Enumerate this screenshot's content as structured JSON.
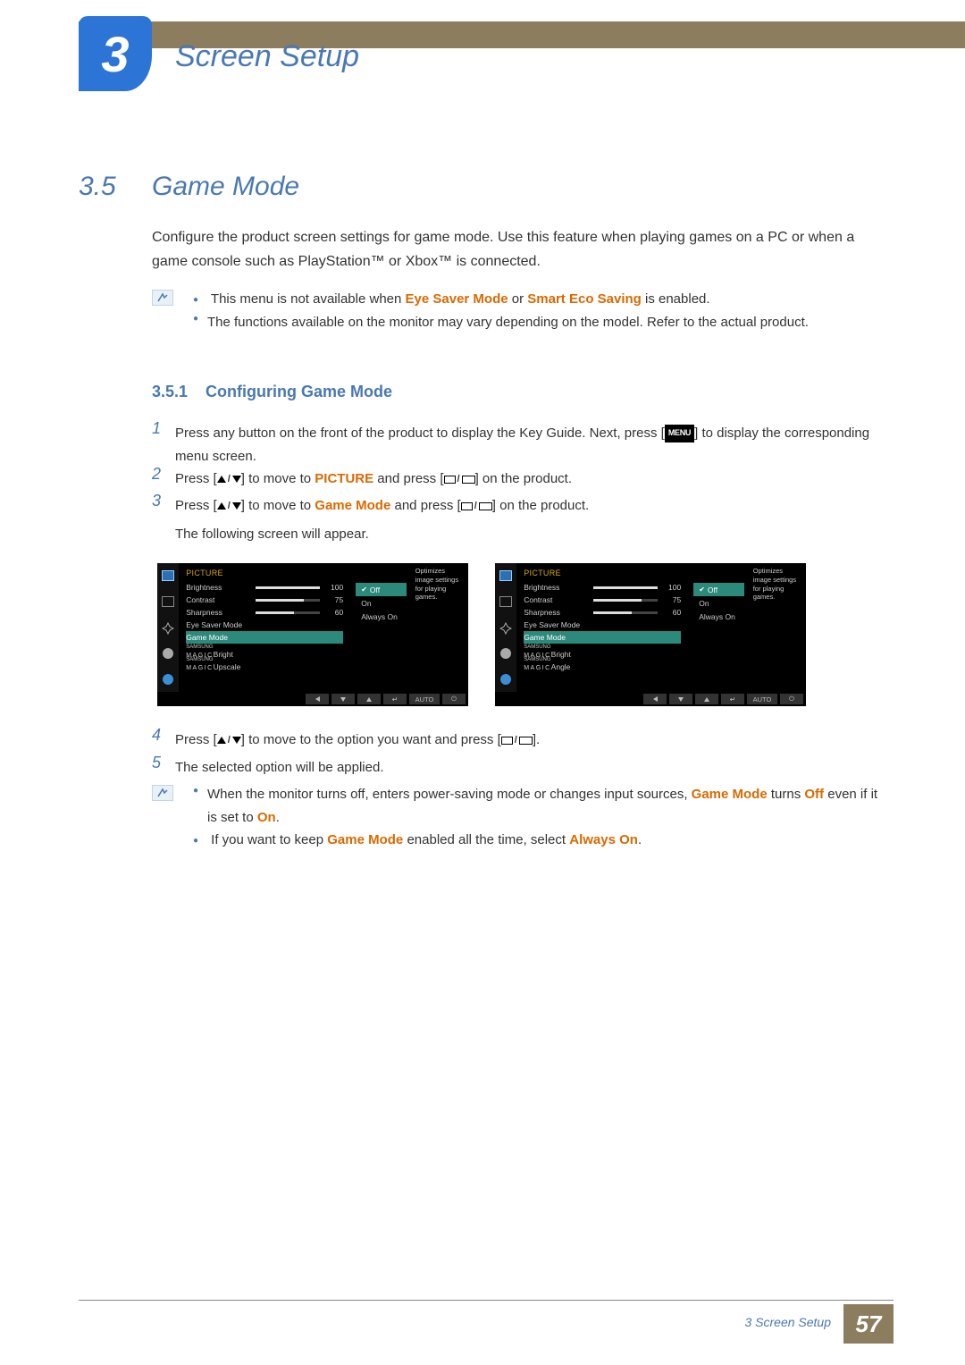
{
  "chapter": {
    "num": "3",
    "title": "Screen Setup"
  },
  "section": {
    "num": "3.5",
    "name": "Game Mode"
  },
  "intro": "Configure the product screen settings for game mode. Use this feature when playing games on a PC or when a game console such as PlayStation™ or Xbox™ is connected.",
  "note1": {
    "i1a": "This menu is not available when ",
    "i1b": "Eye Saver Mode",
    "i1c": " or ",
    "i1d": "Smart Eco Saving",
    "i1e": " is enabled.",
    "i2": "The functions available on the monitor may vary depending on the model. Refer to the actual product."
  },
  "subsection": {
    "num": "3.5.1",
    "name": "Configuring Game Mode"
  },
  "steps": {
    "s1a": "Press any button on the front of the product to display the Key Guide. Next, press [",
    "s1menu": "MENU",
    "s1b": "] to display the corresponding menu screen.",
    "s2a": "Press [",
    "s2b": "] to move to ",
    "s2pic": "PICTURE",
    "s2c": " and press [",
    "s2d": "] on the product.",
    "s3a": "Press [",
    "s3b": "] to move to ",
    "s3gm": "Game Mode",
    "s3c": " and press [",
    "s3d": "] on the product.",
    "s3e": "The following screen will appear.",
    "s4a": "Press [",
    "s4b": "] to move to the option you want and press [",
    "s4c": "].",
    "s5": "The selected option will be applied."
  },
  "osd": {
    "title": "PICTURE",
    "desc": "Optimizes image settings for playing games.",
    "items": {
      "brightness": "Brightness",
      "contrast": "Contrast",
      "sharpness": "Sharpness",
      "eyesaver": "Eye Saver Mode",
      "gamemode": "Game Mode",
      "magic_prefix": "SAMSUNG",
      "magic": "MAGIC",
      "bright": "Bright",
      "upscale": "Upscale",
      "angle": "Angle"
    },
    "vals": {
      "brightness": "100",
      "contrast": "75",
      "sharpness": "60"
    },
    "options": {
      "off": "Off",
      "on": "On",
      "always": "Always On"
    },
    "bottom": {
      "auto": "AUTO"
    }
  },
  "note2": {
    "i1a": "When the monitor turns off, enters power-saving mode or changes input sources, ",
    "i1b": "Game Mode",
    "i1c": " turns ",
    "i1d": "Off",
    "i1e": " even if it is set to ",
    "i1f": "On",
    "i1g": ".",
    "i2a": "If you want to keep ",
    "i2b": "Game Mode",
    "i2c": " enabled all the time, select ",
    "i2d": "Always On",
    "i2e": "."
  },
  "footer": {
    "label": "3 Screen Setup",
    "page": "57"
  }
}
